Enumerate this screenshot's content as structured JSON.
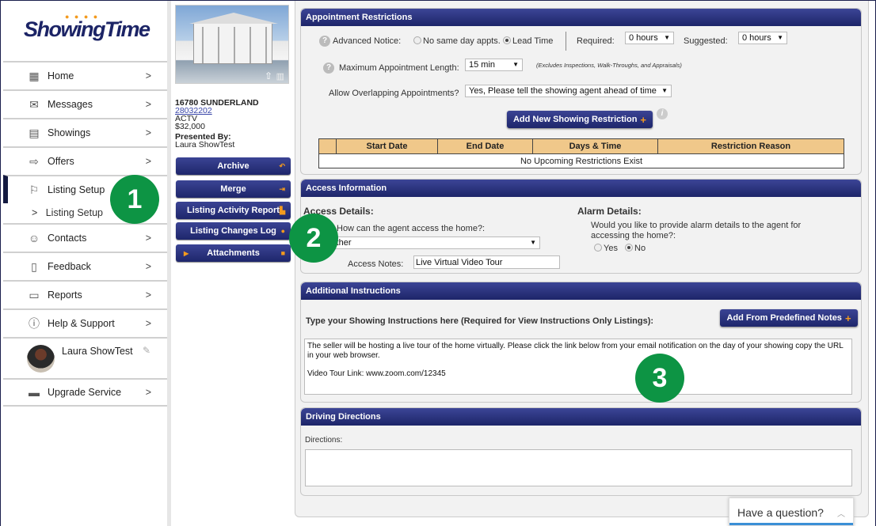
{
  "brand": {
    "logo": "ShowingTime",
    "accent": "#1c2466",
    "orange": "#f39a1e",
    "badge_green": "#0d9444"
  },
  "sidebar": {
    "items": [
      {
        "label": "Home",
        "icon": "dashboard-icon"
      },
      {
        "label": "Messages",
        "icon": "envelope-icon"
      },
      {
        "label": "Showings",
        "icon": "calendar-icon"
      },
      {
        "label": "Offers",
        "icon": "offer-icon"
      },
      {
        "label": "Listing Setup",
        "icon": "flag-icon",
        "active": true
      },
      {
        "label": "Contacts",
        "icon": "contacts-icon"
      },
      {
        "label": "Feedback",
        "icon": "clipboard-icon"
      },
      {
        "label": "Reports",
        "icon": "reports-icon"
      },
      {
        "label": "Help & Support",
        "icon": "help-icon"
      }
    ],
    "sub_item": "Listing Setup",
    "chevron": ">",
    "user": "Laura ShowTest",
    "upgrade": "Upgrade Service"
  },
  "listing": {
    "address": "16780 SUNDERLAND",
    "mls": "28032202",
    "status": "ACTV",
    "price": "$32,000",
    "presented_by_label": "Presented By:",
    "presented_by": "Laura ShowTest",
    "buttons": [
      "Archive",
      "Merge",
      "Listing Activity Report",
      "Listing Changes Log",
      "Attachments"
    ]
  },
  "appointment": {
    "title": "Appointment Restrictions",
    "advanced_notice": "Advanced Notice:",
    "no_same_day": "No same day appts.",
    "lead_time": "Lead Time",
    "required_label": "Required:",
    "required_value": "0 hours",
    "suggested_label": "Suggested:",
    "suggested_value": "0 hours",
    "max_length_label": "Maximum Appointment Length:",
    "max_length_value": "15 min",
    "max_length_note": "(Excludes Inspections, Walk-Throughs, and Appraisals)",
    "overlap_label": "Allow Overlapping Appointments?",
    "overlap_value": "Yes, Please tell the showing agent ahead of time",
    "add_button": "Add New Showing Restriction",
    "columns": [
      "",
      "Start Date",
      "End Date",
      "Days & Time",
      "Restriction Reason"
    ],
    "empty": "No Upcoming Restrictions Exist"
  },
  "access": {
    "title": "Access Information",
    "details_heading": "Access Details:",
    "how_label": "How can the agent access the home?:",
    "how_value": "Other",
    "notes_label": "Access Notes:",
    "notes_value": "Live Virtual Video Tour",
    "alarm_heading": "Alarm Details:",
    "alarm_question": "Would you like to provide alarm details to the agent for accessing the home?:",
    "yes": "Yes",
    "no": "No"
  },
  "instructions": {
    "title": "Additional Instructions",
    "prompt": "Type your Showing Instructions here (Required for View Instructions Only Listings):",
    "add_button": "Add From Predefined Notes",
    "text_line1": "The seller will be hosting a live tour of the home virtually. Please click the link below from your email notification on the day of your showing copy the URL in your web browser.",
    "text_line2": "Video Tour Link: www.zoom.com/12345"
  },
  "directions": {
    "title": "Driving Directions",
    "label": "Directions:",
    "value": ""
  },
  "badges": [
    "1",
    "2",
    "3"
  ],
  "chat": {
    "label": "Have a question?"
  }
}
